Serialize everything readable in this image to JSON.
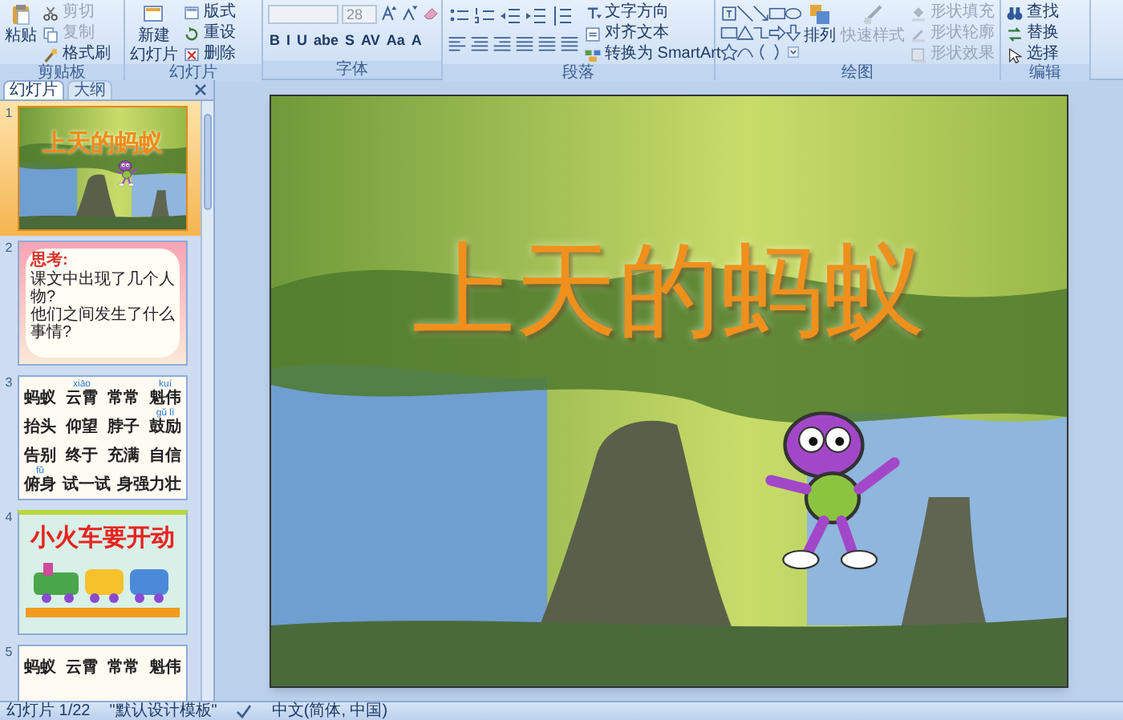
{
  "ribbon": {
    "groups": [
      {
        "label": "剪贴板",
        "controls": [
          {
            "kind": "large",
            "label": "粘贴",
            "disabled": false
          },
          {
            "kind": "small",
            "label": "剪切",
            "disabled": true
          },
          {
            "kind": "small",
            "label": "复制",
            "disabled": true
          },
          {
            "kind": "small",
            "label": "格式刷",
            "disabled": false
          }
        ]
      },
      {
        "label": "幻灯片",
        "controls": [
          {
            "kind": "large",
            "lines": [
              "新建",
              "幻灯片"
            ],
            "disabled": false
          },
          {
            "kind": "small",
            "label": "版式",
            "disabled": false
          },
          {
            "kind": "small",
            "label": "重设",
            "disabled": false
          },
          {
            "kind": "small",
            "label": "删除",
            "disabled": false
          }
        ]
      },
      {
        "label": "字体",
        "controls": [
          {
            "kind": "field",
            "disabled": true
          },
          {
            "kind": "field",
            "value": "28",
            "disabled": true
          },
          {
            "kind": "glyph",
            "label": "B",
            "disabled": false
          },
          {
            "kind": "glyph",
            "label": "I",
            "disabled": false
          },
          {
            "kind": "glyph",
            "label": "U",
            "disabled": false
          },
          {
            "kind": "glyph",
            "label": "abe",
            "disabled": false
          },
          {
            "kind": "glyph",
            "label": "S",
            "disabled": false
          },
          {
            "kind": "glyph",
            "label": "AV",
            "disabled": false
          },
          {
            "kind": "glyph",
            "label": "Aa",
            "disabled": false
          },
          {
            "kind": "glyph",
            "label": "A",
            "disabled": false
          }
        ]
      },
      {
        "label": "段落",
        "controls": [
          {
            "kind": "small",
            "label": "文字方向",
            "disabled": false
          },
          {
            "kind": "small",
            "label": "对齐文本",
            "disabled": false
          },
          {
            "kind": "small",
            "label": "转换为 SmartArt",
            "disabled": false
          }
        ]
      },
      {
        "label": "绘图",
        "controls": [
          {
            "kind": "large",
            "label": "排列",
            "disabled": false
          },
          {
            "kind": "large",
            "label": "快速样式",
            "disabled": true
          },
          {
            "kind": "small",
            "label": "形状填充",
            "disabled": true
          },
          {
            "kind": "small",
            "label": "形状轮廓",
            "disabled": true
          },
          {
            "kind": "small",
            "label": "形状效果",
            "disabled": true
          }
        ]
      },
      {
        "label": "编辑",
        "controls": [
          {
            "kind": "small",
            "label": "查找",
            "disabled": false
          },
          {
            "kind": "small",
            "label": "替换",
            "disabled": false
          },
          {
            "kind": "small",
            "label": "选择",
            "disabled": false
          }
        ]
      }
    ]
  },
  "panel": {
    "tabs": [
      {
        "label": "幻灯片",
        "selected": true
      },
      {
        "label": "大纲",
        "selected": false
      }
    ],
    "slides": [
      {
        "number": "1",
        "selected": true,
        "kind": "title",
        "title": "上天的蚂蚁"
      },
      {
        "number": "2",
        "selected": false,
        "kind": "question",
        "heading": "思考:",
        "lines": [
          "课文中出现了几个人物?",
          "他们之间发生了什么事情?"
        ]
      },
      {
        "number": "3",
        "selected": false,
        "kind": "words",
        "rows": [
          [
            {
              "word": "蚂蚁"
            },
            {
              "word": "云霄",
              "pinyin": "xiāo"
            },
            {
              "word": "常常"
            },
            {
              "word": "魁伟",
              "pinyin": "kuí"
            }
          ],
          [
            {
              "word": "抬头"
            },
            {
              "word": "仰望"
            },
            {
              "word": "脖子"
            },
            {
              "word": "鼓励",
              "pinyin": "gǔ lì"
            }
          ],
          [
            {
              "word": "告别"
            },
            {
              "word": "终于"
            },
            {
              "word": "充满"
            },
            {
              "word": "自信"
            }
          ],
          [
            {
              "word": "俯身",
              "pinyin": "fǔ"
            },
            {
              "word": "试一试"
            },
            {
              "word": "身强力壮"
            }
          ]
        ]
      },
      {
        "number": "4",
        "selected": false,
        "kind": "train",
        "title": "小火车要开动"
      },
      {
        "number": "5",
        "selected": false,
        "kind": "words",
        "rows": [
          [
            {
              "word": "蚂蚁"
            },
            {
              "word": "云霄"
            },
            {
              "word": "常常"
            },
            {
              "word": "魁伟"
            }
          ]
        ]
      }
    ]
  },
  "slide": {
    "title": "上天的蚂蚁"
  },
  "status_bar": {
    "slide": "幻灯片 1/22",
    "theme": "\"默认设计模板\"",
    "language": "中文(简体, 中国)"
  }
}
